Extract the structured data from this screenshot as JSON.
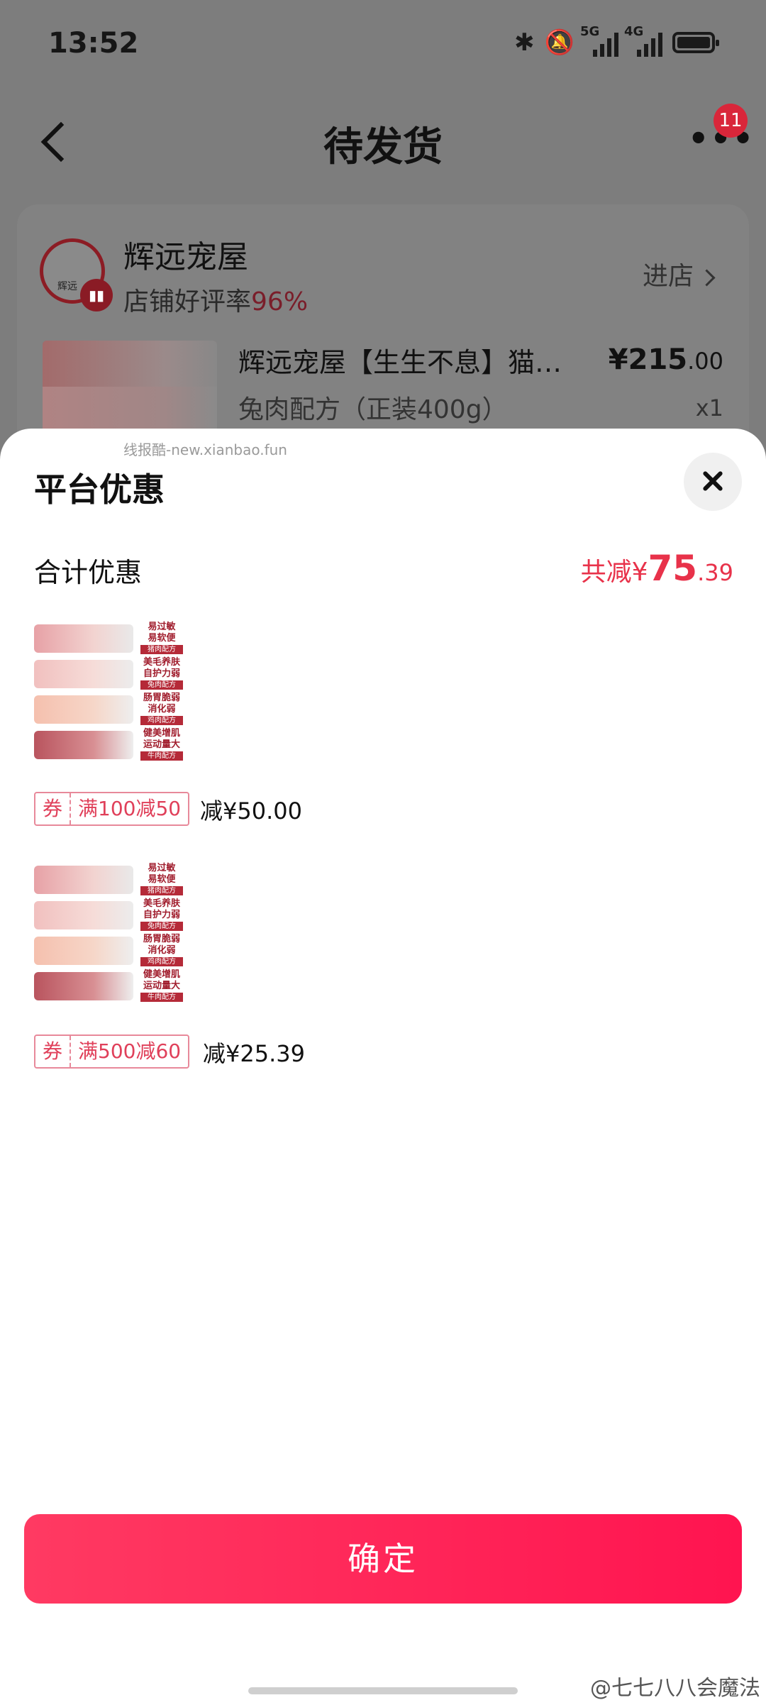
{
  "status_bar": {
    "time": "13:52",
    "net1": "5G",
    "net2": "4G"
  },
  "nav": {
    "title": "待发货",
    "badge": "11",
    "more": "•••"
  },
  "shop": {
    "name": "辉远宠屋",
    "rating_label": "店铺好评率",
    "rating_value": "96%",
    "enter": "进店",
    "logo_text": "辉远"
  },
  "product": {
    "title": "辉远宠屋【生生不息】猫…",
    "spec": "兔肉配方（正装400g）",
    "price_main": "¥215",
    "price_dec": ".00",
    "qty": "x1"
  },
  "sheet": {
    "watermark": "线报酷-new.xianbao.fun",
    "title": "平台优惠",
    "total_label": "合计优惠",
    "total_prefix": "共减",
    "total_yen": "¥",
    "total_int": "75",
    "total_dec": ".39",
    "confirm": "确定"
  },
  "image_tags": [
    {
      "line1": "易过敏",
      "line2": "易软便",
      "foot": "猪肉配方"
    },
    {
      "line1": "美毛养肤",
      "line2": "自护力弱",
      "foot": "兔肉配方"
    },
    {
      "line1": "肠胃脆弱",
      "line2": "消化弱",
      "foot": "鸡肉配方"
    },
    {
      "line1": "健美增肌",
      "line2": "运动量大",
      "foot": "牛肉配方"
    }
  ],
  "deals": [
    {
      "coupon_tag": "券",
      "rule": "满100减50",
      "amount": "减¥50.00"
    },
    {
      "coupon_tag": "券",
      "rule": "满500减60",
      "amount": "减¥25.39"
    }
  ],
  "footer": {
    "weibo": "@七七八八会魔法"
  }
}
